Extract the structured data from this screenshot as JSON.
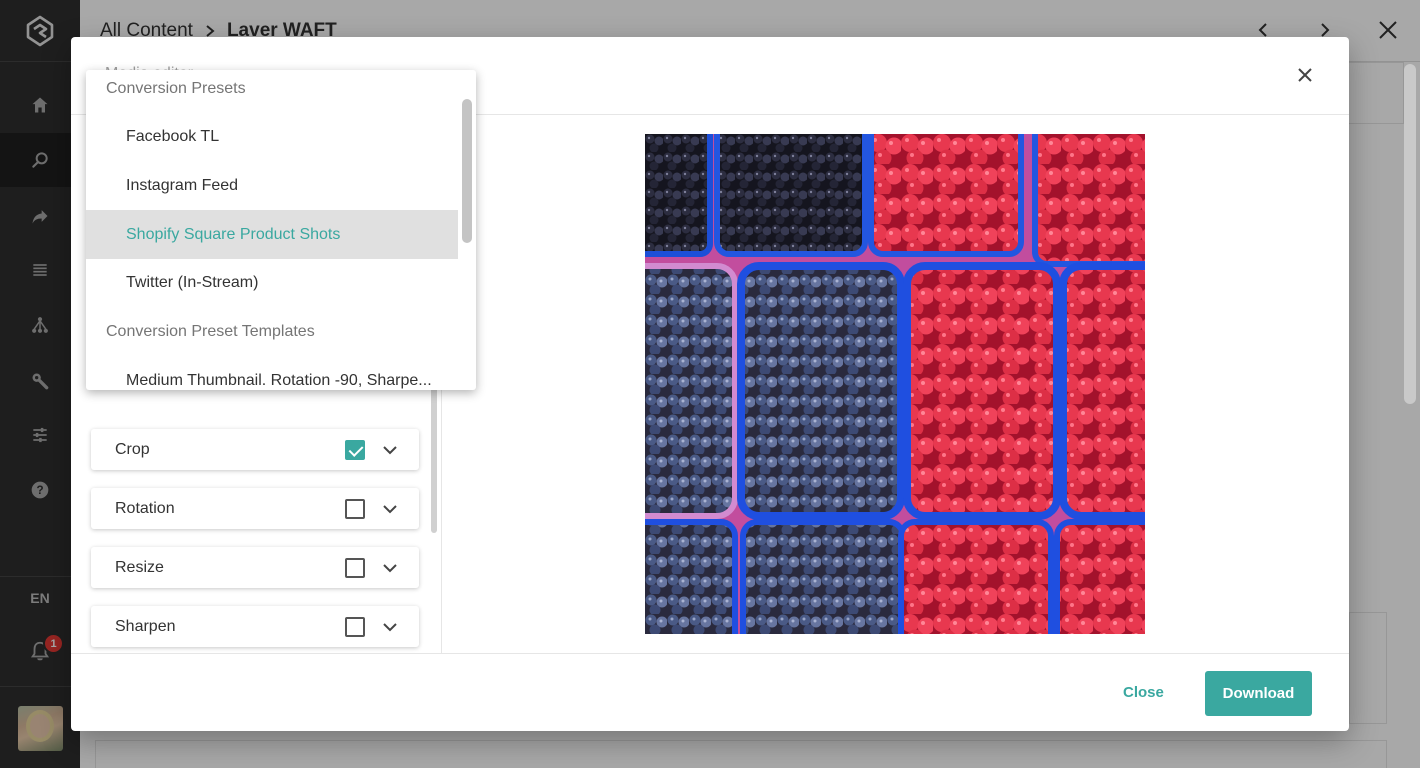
{
  "app": {
    "colors": {
      "accent": "#3aa8a0",
      "sidebar": "#2e2e2e",
      "badge": "#e53935"
    }
  },
  "sidebar": {
    "items": [
      {
        "name": "home",
        "icon": "home-icon"
      },
      {
        "name": "search",
        "icon": "search-icon",
        "active": true
      },
      {
        "name": "share",
        "icon": "share-arrow-icon"
      },
      {
        "name": "list",
        "icon": "list-icon"
      },
      {
        "name": "hierarchy",
        "icon": "hierarchy-icon"
      },
      {
        "name": "tools",
        "icon": "wrench-icon"
      },
      {
        "name": "settings",
        "icon": "sliders-icon"
      },
      {
        "name": "help",
        "icon": "help-icon"
      }
    ],
    "language": "EN",
    "notification_count": "1"
  },
  "header": {
    "breadcrumb_root": "All Content",
    "breadcrumb_current": "Laver WAFT"
  },
  "modal": {
    "title": "Media editor",
    "close_label": "Close",
    "download_label": "Download",
    "options": [
      {
        "label": "Crop",
        "checked": true
      },
      {
        "label": "Rotation",
        "checked": false
      },
      {
        "label": "Resize",
        "checked": false
      },
      {
        "label": "Sharpen",
        "checked": false
      }
    ]
  },
  "dropdown": {
    "group1": "Conversion Presets",
    "presets": [
      "Facebook TL",
      "Instagram Feed",
      "Shopify Square Product Shots",
      "Twitter (In-Stream)"
    ],
    "selected": "Shopify Square Product Shots",
    "group2": "Conversion Preset Templates",
    "templates": [
      "Medium Thumbnail. Rotation -90, Sharpe..."
    ]
  }
}
